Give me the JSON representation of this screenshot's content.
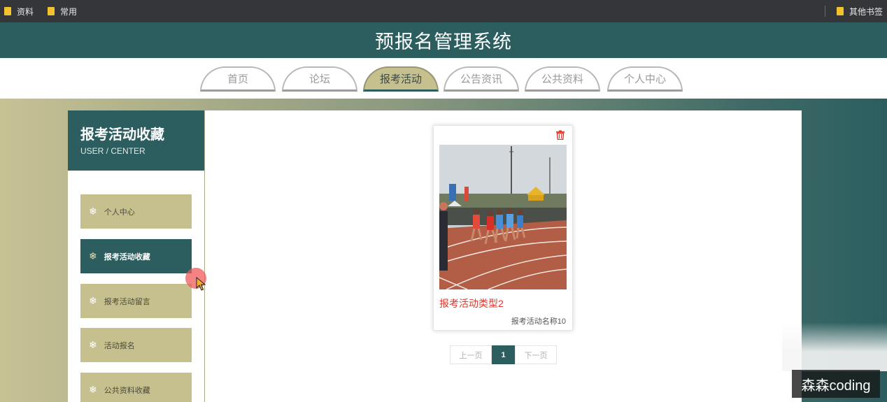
{
  "bookmarks": {
    "left": [
      "资料",
      "常用"
    ],
    "right": "其他书签",
    "folder_color": "#f2c230"
  },
  "header": {
    "title": "预报名管理系统",
    "color": "#2c5e60"
  },
  "nav": {
    "tabs": [
      "首页",
      "论坛",
      "报考活动",
      "公告资讯",
      "公共资料",
      "个人中心"
    ],
    "active": "报考活动",
    "active_color": "#c6c08f"
  },
  "sidebar": {
    "title": "报考活动收藏",
    "subtitle": "USER / CENTER",
    "items": [
      "个人中心",
      "报考活动收藏",
      "报考活动留言",
      "活动报名",
      "公共资料收藏"
    ],
    "active_item": "报考活动收藏",
    "item_icon": "snowflake-icon"
  },
  "card": {
    "title": "报考活动类型2",
    "subtitle": "报考活动名称10",
    "image": "track-race-photo",
    "delete_icon": "trash-icon"
  },
  "pagination": {
    "prev": "上一页",
    "current": "1",
    "next": "下一页"
  },
  "watermark": "森森coding"
}
